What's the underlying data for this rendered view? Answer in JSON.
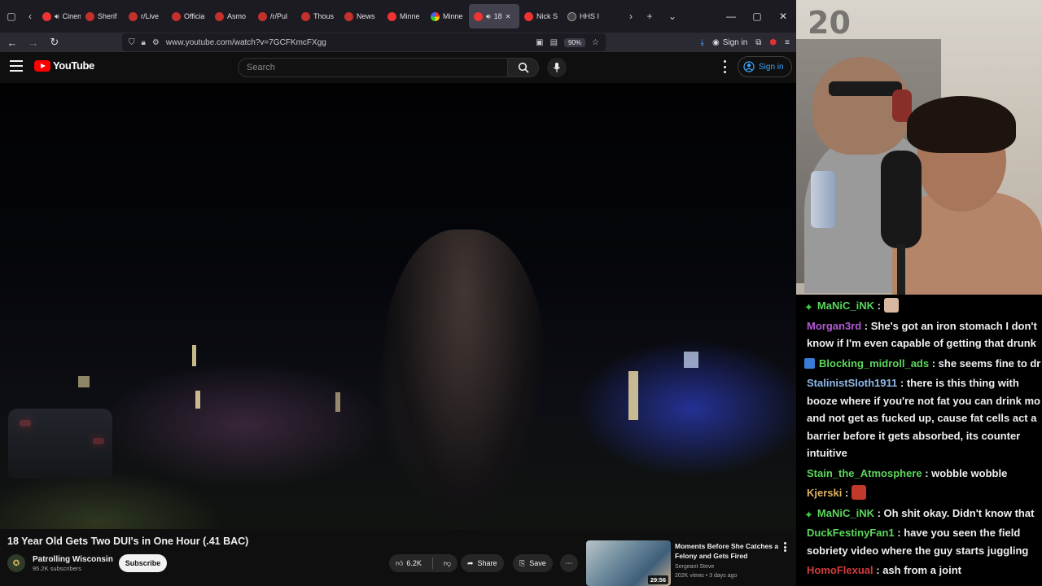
{
  "browser": {
    "tabs": [
      {
        "label": "Cinem",
        "fav": "red2",
        "audio": true
      },
      {
        "label": "Sherif",
        "fav": "red",
        "audio": false
      },
      {
        "label": "r/Live",
        "fav": "red",
        "audio": false
      },
      {
        "label": "Officia",
        "fav": "red",
        "audio": false
      },
      {
        "label": "Asmo",
        "fav": "red",
        "audio": false
      },
      {
        "label": "/r/Pul",
        "fav": "red",
        "audio": false
      },
      {
        "label": "Thous",
        "fav": "red",
        "audio": false
      },
      {
        "label": "News",
        "fav": "red",
        "audio": false
      },
      {
        "label": "Minne",
        "fav": "red2",
        "audio": false
      },
      {
        "label": "Minne",
        "fav": "multi",
        "audio": false
      },
      {
        "label": "18",
        "fav": "red2",
        "audio": true,
        "active": true
      },
      {
        "label": "Nick S",
        "fav": "red2",
        "audio": false
      },
      {
        "label": "HHS I",
        "fav": "dark",
        "audio": false
      }
    ],
    "url": "www.youtube.com/watch?v=7GCFKmcFXgg",
    "zoom": "90%",
    "signin_label": "Sign in"
  },
  "youtube": {
    "logo_text": "YouTube",
    "search_placeholder": "Search",
    "signin_label": "Sign in",
    "video": {
      "title": "18 Year Old Gets Two DUI's in One Hour (.41 BAC)",
      "channel": "Patrolling Wisconsin",
      "subscribers": "95.2K subscribers",
      "subscribe_label": "Subscribe",
      "likes": "6.2K",
      "share_label": "Share",
      "save_label": "Save"
    },
    "recommended": {
      "title": "Moments Before She Catches a Felony and Gets Fired",
      "channel": "Sergeant Steve",
      "stats": "202K views • 3 days ago",
      "duration": "29:56"
    }
  },
  "stream": {
    "overlay_number": "20",
    "chat": [
      {
        "user": "MaNiC_iNK",
        "color": "#5cd65c",
        "badge": "green-diamond",
        "text": "",
        "emote": "face-emote"
      },
      {
        "user": "Morgan3rd",
        "color": "#b45ad6",
        "badge": "",
        "text": "She's got an iron stomach I don't know if I'm even capable of getting that drunk"
      },
      {
        "user": "Blocking_midroll_ads",
        "color": "#5cd65c",
        "badge": "blue-badge",
        "text": "she seems fine to dr",
        "nowrap": true
      },
      {
        "user": "StalinistSloth1911",
        "color": "#8fb8e8",
        "badge": "",
        "text": "there is this thing with booze where if you're not fat you can drink mo and not get as fucked up, cause fat cells act a barrier before it gets absorbed, its counter intuitive"
      },
      {
        "user": "Stain_the_Atmosphere",
        "color": "#5cd65c",
        "badge": "",
        "text": "wobble wobble"
      },
      {
        "user": "Kjerski",
        "color": "#e0b060",
        "badge": "",
        "text": "",
        "emote": "red-emote"
      },
      {
        "user": "MaNiC_iNK",
        "color": "#5cd65c",
        "badge": "green-diamond",
        "text": "Oh shit okay. Didn't know that"
      },
      {
        "user": "DuckFestinyFan1",
        "color": "#5cd65c",
        "badge": "",
        "text": "have you seen the field sobriety video where the guy starts juggling"
      },
      {
        "user": "HomoFlexual",
        "color": "#d23c3c",
        "badge": "",
        "text": "ash from a joint"
      }
    ]
  }
}
